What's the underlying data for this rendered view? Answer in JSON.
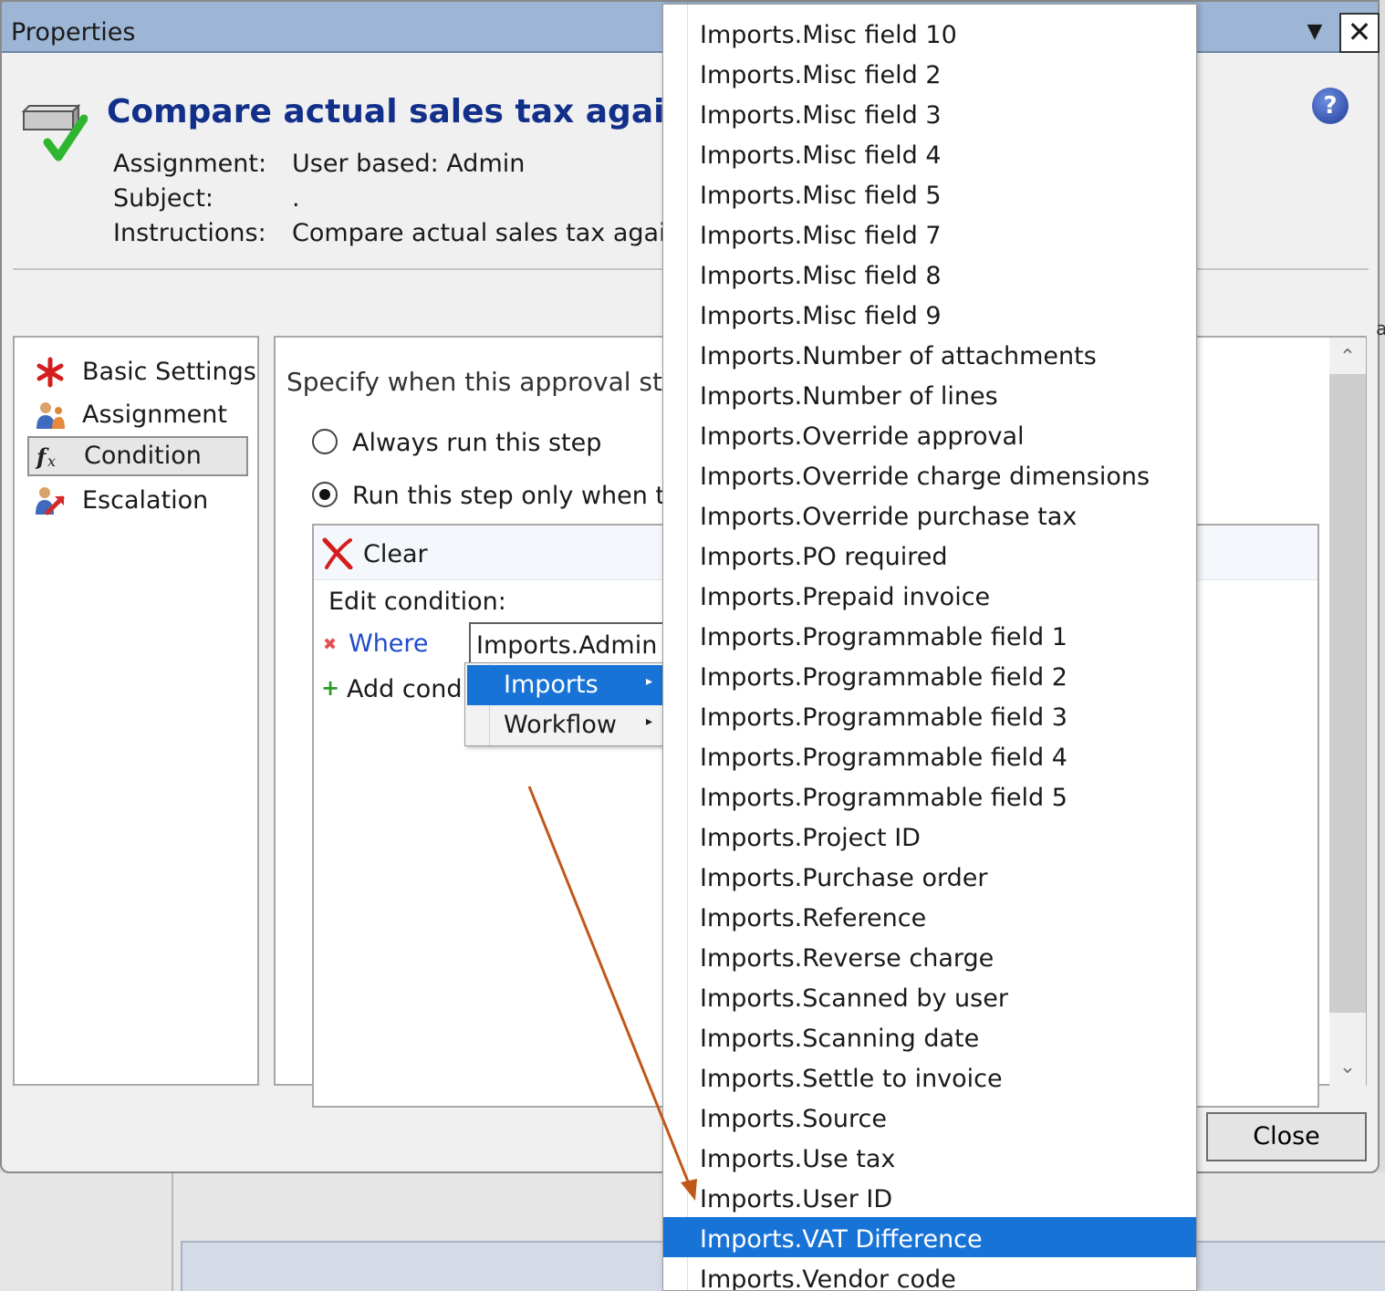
{
  "window": {
    "title": "Properties",
    "dropdown_glyph": "▼",
    "close_glyph": "✕"
  },
  "header": {
    "title": "Compare actual sales tax against lin",
    "assignment_label": "Assignment:",
    "assignment_value": "User based: Admin",
    "subject_label": "Subject:",
    "subject_value": ".",
    "instructions_label": "Instructions:",
    "instructions_value": "Compare actual sales tax against",
    "help_glyph": "?"
  },
  "nav": {
    "items": [
      {
        "label": "Basic Settings",
        "icon": "red-asterisk-icon"
      },
      {
        "label": "Assignment",
        "icon": "users-icon"
      },
      {
        "label": "Condition",
        "icon": "function-icon",
        "selected": true
      },
      {
        "label": "Escalation",
        "icon": "escalation-icon"
      }
    ]
  },
  "condition": {
    "prompt": "Specify when this approval step",
    "always_label": "Always run this step",
    "only_when_label": "Run this step only when the",
    "selected_option": "only_when",
    "clear_label": "Clear",
    "edit_label": "Edit condition:",
    "where_label": "Where",
    "where_field": "Imports.Admin co",
    "add_label": "Add condit"
  },
  "submenu": {
    "items": [
      {
        "label": "Imports",
        "highlighted": true
      },
      {
        "label": "Workflow",
        "highlighted": false
      }
    ],
    "arrow_glyph": "▸"
  },
  "dropdown": {
    "items": [
      "Imports.Misc field 10",
      "Imports.Misc field 2",
      "Imports.Misc field 3",
      "Imports.Misc field 4",
      "Imports.Misc field 5",
      "Imports.Misc field 7",
      "Imports.Misc field 8",
      "Imports.Misc field 9",
      "Imports.Number of attachments",
      "Imports.Number of lines",
      "Imports.Override approval",
      "Imports.Override charge dimensions",
      "Imports.Override purchase tax",
      "Imports.PO required",
      "Imports.Prepaid invoice",
      "Imports.Programmable field 1",
      "Imports.Programmable field 2",
      "Imports.Programmable field 3",
      "Imports.Programmable field 4",
      "Imports.Programmable field 5",
      "Imports.Project ID",
      "Imports.Purchase order",
      "Imports.Reference",
      "Imports.Reverse charge",
      "Imports.Scanned by user",
      "Imports.Scanning date",
      "Imports.Settle to invoice",
      "Imports.Source",
      "Imports.Use tax",
      "Imports.User ID",
      "Imports.VAT Difference",
      "Imports.Vendor code"
    ],
    "highlighted_item": "Imports.VAT Difference"
  },
  "buttons": {
    "close_label": "Close"
  },
  "side_fragment": "a",
  "colors": {
    "titlebar": "#9db6d6",
    "accent_blue": "#1773d6",
    "title_blue": "#12308a",
    "annotation_arrow": "#c0571a"
  }
}
